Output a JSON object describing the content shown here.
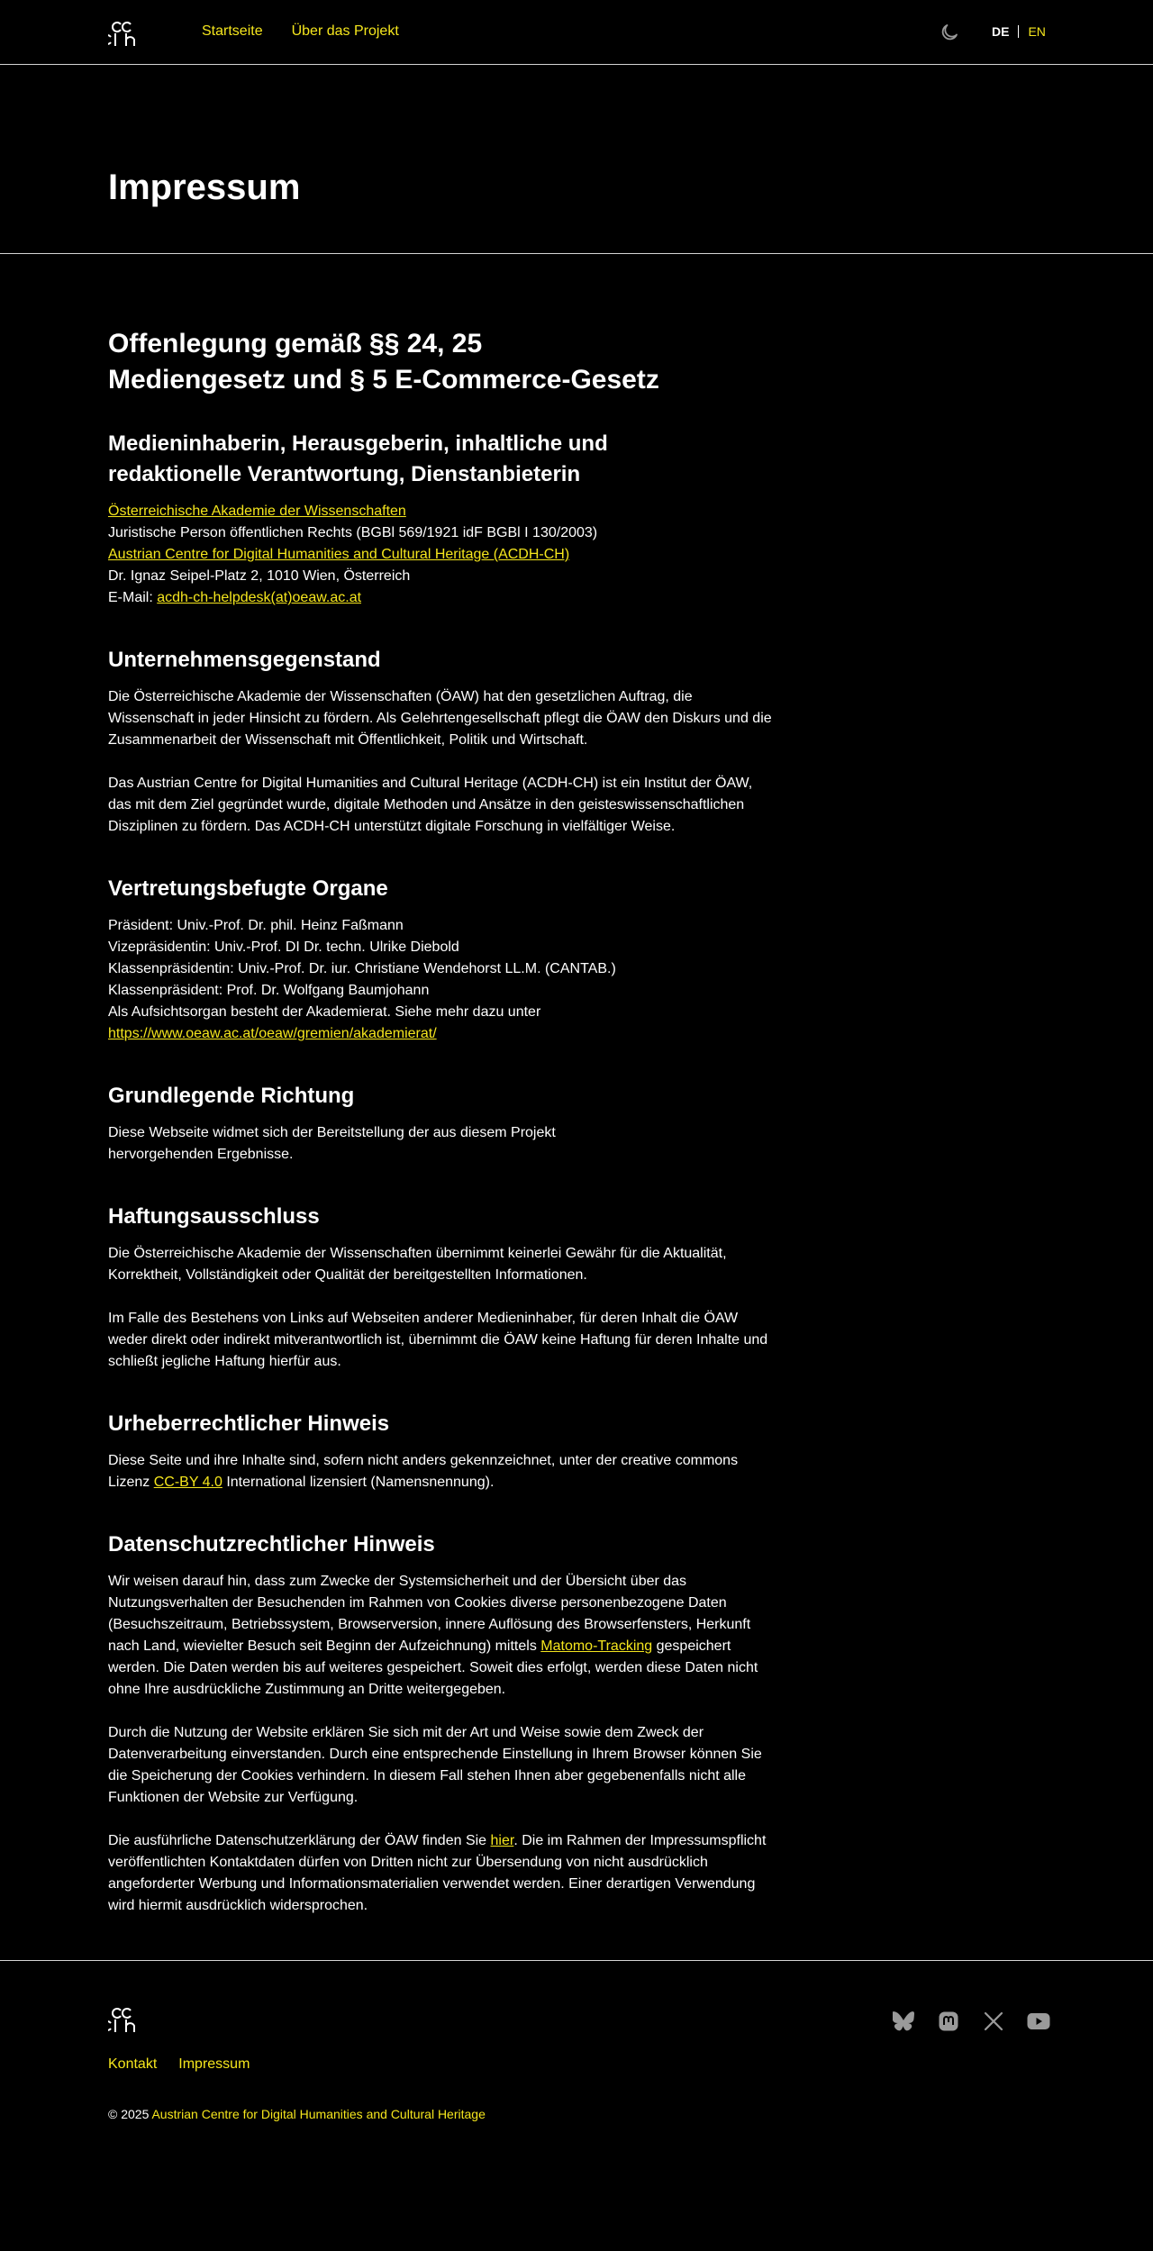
{
  "header": {
    "nav": [
      "Startseite",
      "Über das Projekt"
    ],
    "lang_active": "DE",
    "lang_other": "EN"
  },
  "hero": {
    "title": "Impressum"
  },
  "disclosure": {
    "title_line1": "Offenlegung gemäß §§ 24, 25",
    "title_line2": "Mediengesetz und § 5 E-Commerce-Gesetz"
  },
  "owner": {
    "heading": "Medieninhaberin, Herausgeberin, inhaltliche und redaktionelle Verantwortung, Dienstanbieterin",
    "academy_link": "Österreichische Akademie der Wissenschaften",
    "legal_status": "Juristische Person öffentlichen Rechts (BGBl 569/1921 idF BGBl I 130/2003)",
    "institute_link": "Austrian Centre for Digital Humanities and Cultural Heritage (ACDH-CH)",
    "address": "Dr. Ignaz Seipel-Platz 2, 1010 Wien, Österreich",
    "email_label": "E-Mail: ",
    "email": "acdh-ch-helpdesk(at)oeaw.ac.at"
  },
  "purpose": {
    "heading": "Unternehmensgegenstand",
    "p1": "Die Österreichische Akademie der Wissenschaften (ÖAW) hat den gesetzlichen Auftrag, die Wissenschaft in jeder Hinsicht zu fördern. Als Gelehrtengesellschaft pflegt die ÖAW den Diskurs und die Zusammenarbeit der Wissenschaft mit Öffentlichkeit, Politik und Wirtschaft.",
    "p2": "Das Austrian Centre for Digital Humanities and Cultural Heritage (ACDH-CH) ist ein Institut der ÖAW, das mit dem Ziel gegründet wurde, digitale Methoden und Ansätze in den geisteswissenschaftlichen Disziplinen zu fördern. Das ACDH-CH unterstützt digitale Forschung in vielfältiger Weise."
  },
  "organs": {
    "heading": "Vertretungsbefugte Organe",
    "lines": [
      "Präsident: Univ.-Prof. Dr. phil. Heinz Faßmann",
      "Vizepräsidentin: Univ.-Prof. DI Dr. techn. Ulrike Diebold",
      "Klassenpräsidentin: Univ.-Prof. Dr. iur. Christiane Wendehorst LL.M. (CANTAB.)",
      "Klassenpräsident: Prof. Dr. Wolfgang Baumjohann",
      "Als Aufsichtsorgan besteht der Akademierat. Siehe mehr dazu unter"
    ],
    "link": "https://www.oeaw.ac.at/oeaw/gremien/akademierat/"
  },
  "direction": {
    "heading": "Grundlegende Richtung",
    "text": "Diese Webseite widmet sich der Bereitstellung der aus diesem Projekt hervorgehenden Ergebnisse."
  },
  "liability": {
    "heading": "Haftungsausschluss",
    "p1": "Die Österreichische Akademie der Wissenschaften übernimmt keinerlei Gewähr für die Aktualität, Korrektheit, Vollständigkeit oder Qualität der bereitgestellten Informationen.",
    "p2": "Im Falle des Bestehens von Links auf Webseiten anderer Medieninhaber, für deren Inhalt die ÖAW weder direkt oder indirekt mitverantwortlich ist, übernimmt die ÖAW keine Haftung für deren Inhalte und schließt jegliche Haftung hierfür aus."
  },
  "copyright_notice": {
    "heading": "Urheberrechtlicher Hinweis",
    "before": "Diese Seite und ihre Inhalte sind, sofern nicht anders gekennzeichnet, unter der creative commons Lizenz ",
    "link": "CC-BY 4.0",
    "after": " International lizensiert (Namensnennung)."
  },
  "privacy": {
    "heading": "Datenschutzrechtlicher Hinweis",
    "p1_before": "Wir weisen darauf hin, dass zum Zwecke der Systemsicherheit und der Übersicht über das Nutzungsverhalten der Besuchenden im Rahmen von Cookies diverse personenbezogene Daten (Besuchszeitraum, Betriebssystem, Browserversion, innere Auflösung des Browserfensters, Herkunft nach Land, wievielter Besuch seit Beginn der Aufzeichnung) mittels ",
    "p1_link": "Matomo-Tracking",
    "p1_after": " gespeichert werden. Die Daten werden bis auf weiteres gespeichert. Soweit dies erfolgt, werden diese Daten nicht ohne Ihre ausdrückliche Zustimmung an Dritte weitergegeben.",
    "p2": "Durch die Nutzung der Website erklären Sie sich mit der Art und Weise sowie dem Zweck der Datenverarbeitung einverstanden. Durch eine entsprechende Einstellung in Ihrem Browser können Sie die Speicherung der Cookies verhindern. In diesem Fall stehen Ihnen aber gegebenenfalls nicht alle Funktionen der Website zur Verfügung.",
    "p3_before": "Die ausführliche Datenschutzerklärung der ÖAW finden Sie ",
    "p3_link": "hier",
    "p3_after": ". Die im Rahmen der Impressumspflicht veröffentlichten Kontaktdaten dürfen von Dritten nicht zur Übersendung von nicht ausdrücklich angeforderter Werbung und Informationsmaterialien verwendet werden. Einer derartigen Verwendung wird hiermit ausdrücklich widersprochen."
  },
  "footer": {
    "links": [
      "Kontakt",
      "Impressum"
    ],
    "copyright_prefix": "© 2025 ",
    "copyright_link": "Austrian Centre for Digital Humanities and Cultural Heritage"
  },
  "colors": {
    "accent": "#f5e61d",
    "background": "#000000",
    "text": "#ffffff",
    "icon_gray": "#9a9a9a"
  }
}
